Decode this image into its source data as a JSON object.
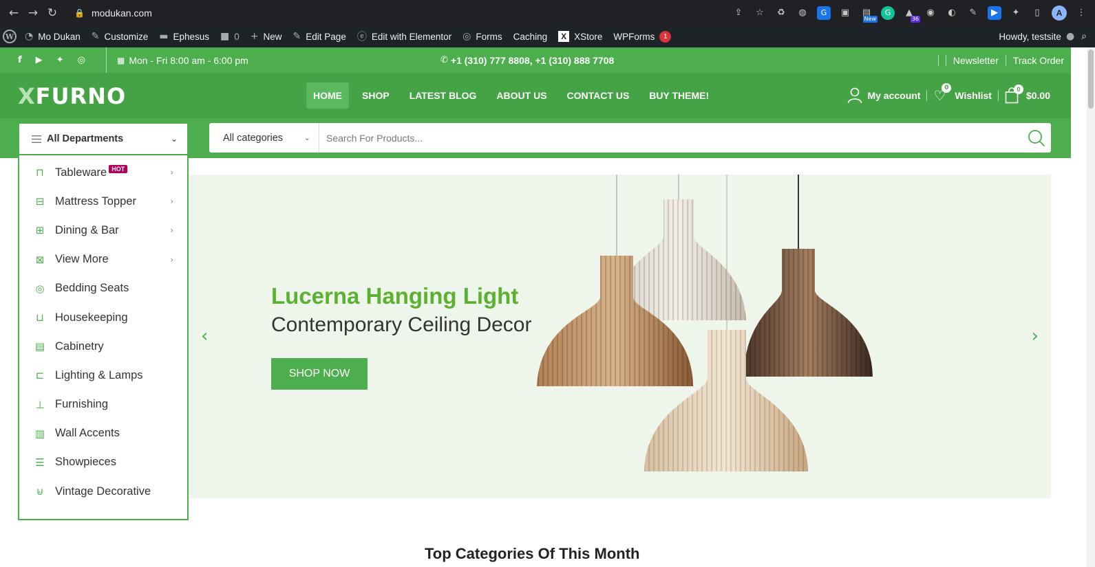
{
  "browser": {
    "url": "modukan.com",
    "profile_initial": "A",
    "ext_badge_new": "New",
    "ext_badge_count": "36"
  },
  "wpbar": {
    "site": "Mo Dukan",
    "customize": "Customize",
    "theme": "Ephesus",
    "comments": "0",
    "new": "New",
    "edit_page": "Edit Page",
    "edit_elementor": "Edit with Elementor",
    "forms": "Forms",
    "caching": "Caching",
    "xstore": "XStore",
    "wpforms": "WPForms",
    "wpforms_count": "1",
    "howdy": "Howdy, testsite"
  },
  "topbar": {
    "hours": "Mon - Fri 8:00 am - 6:00 pm",
    "phone": "+1 (310) 777 8808, +1 (310) 888 7708",
    "newsletter": "Newsletter",
    "track_order": "Track Order"
  },
  "header": {
    "logo_x": "X",
    "logo_rest": "FURNO",
    "nav": [
      "HOME",
      "SHOP",
      "LATEST BLOG",
      "ABOUT US",
      "CONTACT US",
      "BUY THEME!"
    ],
    "account": "My account",
    "wishlist": "Wishlist",
    "wishlist_count": "0",
    "cart_count": "0",
    "cart_total": "$0.00"
  },
  "departments": {
    "title": "All Departments",
    "hot": "HOT",
    "items": [
      {
        "label": "Tableware",
        "icon": "table-icon",
        "arrow": true
      },
      {
        "label": "Mattress Topper",
        "icon": "bed-icon",
        "arrow": true
      },
      {
        "label": "Dining & Bar",
        "icon": "sofa-icon",
        "arrow": true
      },
      {
        "label": "View More",
        "icon": "furniture-icon",
        "arrow": true
      },
      {
        "label": "Bedding Seats",
        "icon": "chair-icon",
        "arrow": false
      },
      {
        "label": "Housekeeping",
        "icon": "couch-icon",
        "arrow": false
      },
      {
        "label": "Cabinetry",
        "icon": "cabinet-icon",
        "arrow": false
      },
      {
        "label": "Lighting & Lamps",
        "icon": "lamp-icon",
        "arrow": false
      },
      {
        "label": "Furnishing",
        "icon": "desk-icon",
        "arrow": false
      },
      {
        "label": "Wall Accents",
        "icon": "wardrobe-icon",
        "arrow": false
      },
      {
        "label": "Showpieces",
        "icon": "shelf-icon",
        "arrow": false
      },
      {
        "label": "Vintage Decorative",
        "icon": "bathtub-icon",
        "arrow": false
      }
    ]
  },
  "search": {
    "category": "All categories",
    "placeholder": "Search For Products..."
  },
  "hero": {
    "title": "Lucerna Hanging Light",
    "subtitle": "Contemporary Ceiling Decor",
    "button": "SHOP NOW"
  },
  "section": {
    "title": "Top Categories Of This Month"
  },
  "colors": {
    "green": "#4cae4c",
    "green_dark": "#44a344",
    "hero_title": "#5cb130",
    "hot_badge": "#b4005a"
  }
}
